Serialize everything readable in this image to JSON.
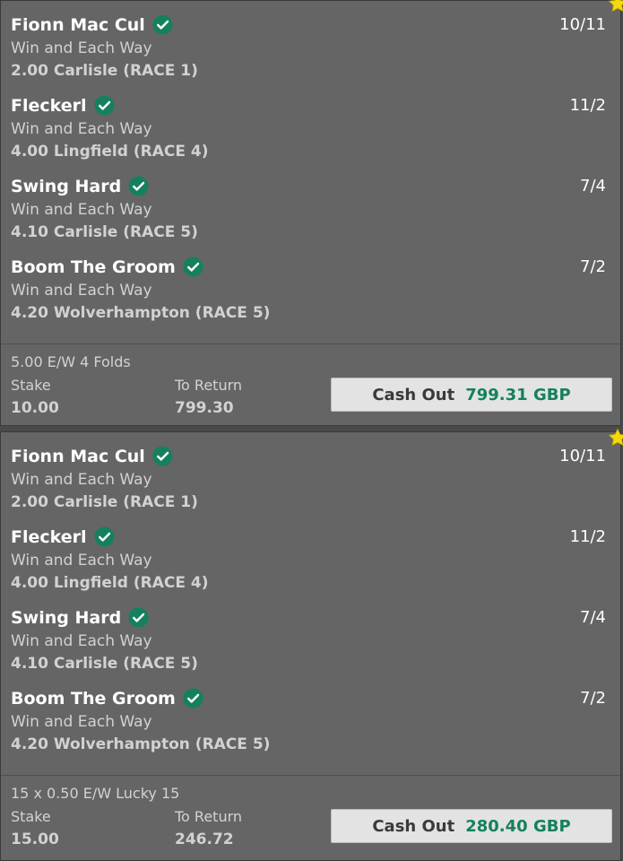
{
  "colors": {
    "card": "#656565",
    "check": "#14805e",
    "star": "#f5d90c",
    "cashout_amount": "#14805e"
  },
  "bets": [
    {
      "starred": true,
      "selections": [
        {
          "name": "Fionn Mac Cul",
          "odds": "10/11",
          "market": "Win and Each Way",
          "event": "2.00 Carlisle (RACE 1)"
        },
        {
          "name": "Fleckerl",
          "odds": "11/2",
          "market": "Win and Each Way",
          "event": "4.00 Lingfield (RACE 4)"
        },
        {
          "name": "Swing Hard",
          "odds": "7/4",
          "market": "Win and Each Way",
          "event": "4.10 Carlisle (RACE 5)"
        },
        {
          "name": "Boom The Groom",
          "odds": "7/2",
          "market": "Win and Each Way",
          "event": "4.20 Wolverhampton (RACE 5)"
        }
      ],
      "bet_type": "5.00 E/W 4 Folds",
      "stake_label": "Stake",
      "stake": "10.00",
      "return_label": "To Return",
      "to_return": "799.30",
      "cashout_label": "Cash Out",
      "cashout_amount": "799.31 GBP"
    },
    {
      "starred": true,
      "selections": [
        {
          "name": "Fionn Mac Cul",
          "odds": "10/11",
          "market": "Win and Each Way",
          "event": "2.00 Carlisle (RACE 1)"
        },
        {
          "name": "Fleckerl",
          "odds": "11/2",
          "market": "Win and Each Way",
          "event": "4.00 Lingfield (RACE 4)"
        },
        {
          "name": "Swing Hard",
          "odds": "7/4",
          "market": "Win and Each Way",
          "event": "4.10 Carlisle (RACE 5)"
        },
        {
          "name": "Boom The Groom",
          "odds": "7/2",
          "market": "Win and Each Way",
          "event": "4.20 Wolverhampton (RACE 5)"
        }
      ],
      "bet_type": "15 x 0.50 E/W Lucky 15",
      "stake_label": "Stake",
      "stake": "15.00",
      "return_label": "To Return",
      "to_return": "246.72",
      "cashout_label": "Cash Out",
      "cashout_amount": "280.40 GBP"
    }
  ]
}
